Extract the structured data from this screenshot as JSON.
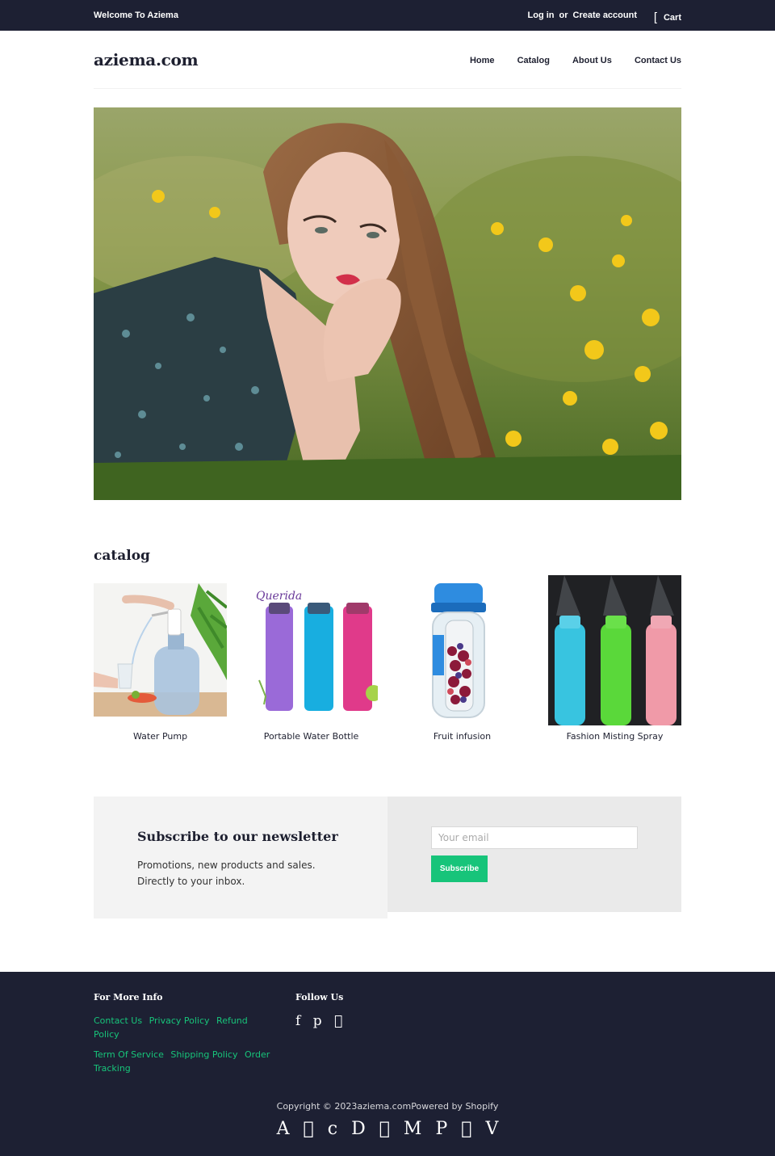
{
  "topbar": {
    "welcome": "Welcome To Aziema",
    "login": "Log in",
    "or": "or",
    "create_account": "Create account",
    "cart_icon": "[",
    "cart": "Cart"
  },
  "header": {
    "logo": "aziema.com",
    "nav": [
      "Home",
      "Catalog",
      "About Us",
      "Contact Us"
    ]
  },
  "hero": {
    "image": "woman-lying-in-dandelion-field"
  },
  "catalog": {
    "title": "catalog",
    "products": [
      {
        "name": "Water Pump",
        "image": "water-pump-on-jug"
      },
      {
        "name": "Portable Water Bottle",
        "image": "querida-bottles"
      },
      {
        "name": "Fruit infusion",
        "image": "fruit-infuser-bottle"
      },
      {
        "name": "Fashion Misting Spray",
        "image": "misting-spray-bottles"
      }
    ],
    "bottle_brand": "Querida"
  },
  "newsletter": {
    "title": "Subscribe to our newsletter",
    "line1": "Promotions, new products and sales.",
    "line2": "Directly to your inbox.",
    "email_placeholder": "Your email",
    "button": "Subscribe"
  },
  "footer": {
    "info_heading": "For More Info",
    "links_row1": [
      "Contact Us",
      "Privacy Policy",
      "Refund Policy"
    ],
    "links_row2": [
      "Term Of Service",
      "Shipping Policy",
      "Order Tracking"
    ],
    "follow_heading": "Follow Us",
    "social": [
      "f",
      "p",
      ""
    ],
    "copyright": "Copyright © 2023",
    "site": "aziema.com",
    "powered": "Powered by Shopify",
    "payments": [
      "A",
      "",
      "c",
      "D",
      "",
      "M",
      "P",
      "",
      "V"
    ]
  },
  "colors": {
    "dark": "#1d2033",
    "accent": "#17c47a",
    "panel_light": "#f3f3f3",
    "panel_mid": "#eaeaea"
  }
}
